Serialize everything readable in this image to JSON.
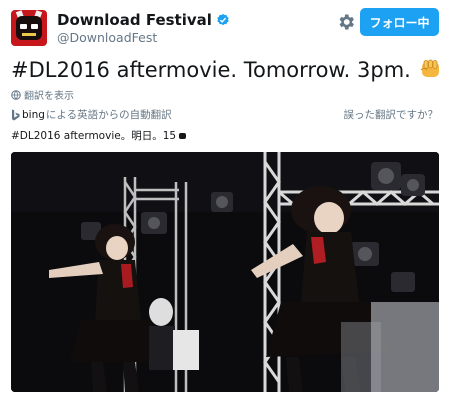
{
  "account": {
    "display_name": "Download Festival",
    "handle": "@DownloadFest",
    "verified_icon": "verified-badge-icon",
    "avatar_icon": "avatar-mask-icon"
  },
  "actions": {
    "follow_label": "フォロー中",
    "settings_icon": "gear-icon"
  },
  "tweet": {
    "text": "#DL2016 aftermovie. Tomorrow. 3pm.",
    "emoji_icon": "fist-emoji-icon"
  },
  "translation": {
    "show_label": "翻訳を表示",
    "bing_brand": "bing",
    "bing_note": "による英語からの自動翻訳",
    "wrong_label": "誤った翻訳ですか？",
    "translated_text": "#DL2016 aftermovie。明日。15"
  },
  "media": {
    "kind": "video-still",
    "description_icon": "concert-video-icon"
  },
  "colors": {
    "brand_blue": "#1da1f2",
    "text_primary": "#14171a",
    "text_secondary": "#657786"
  }
}
